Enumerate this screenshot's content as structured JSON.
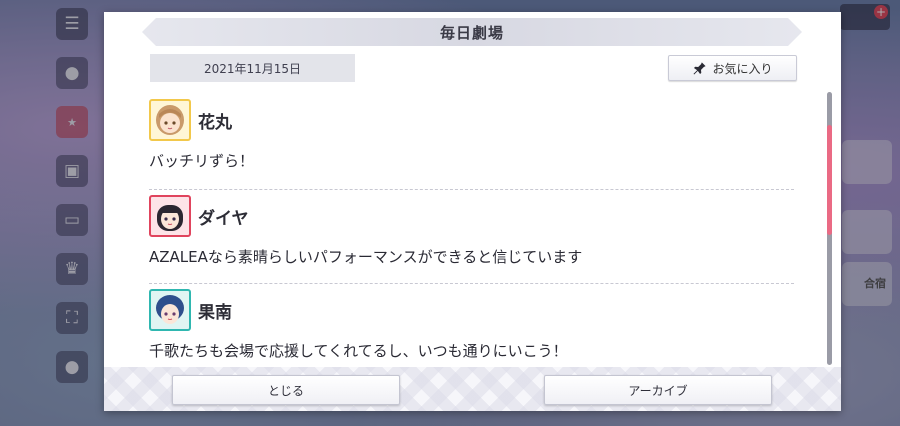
{
  "dialog": {
    "title": "毎日劇場",
    "date": "2021年11月15日",
    "favorite_label": "お気に入り",
    "entries": [
      {
        "name": "花丸",
        "message": "バッチリずら！",
        "avatar_color": "#f2c84b"
      },
      {
        "name": "ダイヤ",
        "message": "AZALEAなら素晴らしいパフォーマンスができると信じています",
        "avatar_color": "#e0445d"
      },
      {
        "name": "果南",
        "message": "千歌たちも会場で応援してくれてるし、いつも通りにいこう！",
        "avatar_color": "#2fb7b0"
      }
    ],
    "close_label": "とじる",
    "archive_label": "アーカイブ",
    "scroll_position": 0.2
  },
  "background": {
    "right_label": "合宿"
  },
  "colors": {
    "accent_pink": "#ea6a84",
    "yellow": "#f2c84b",
    "red": "#e0445d",
    "teal": "#2fb7b0"
  }
}
